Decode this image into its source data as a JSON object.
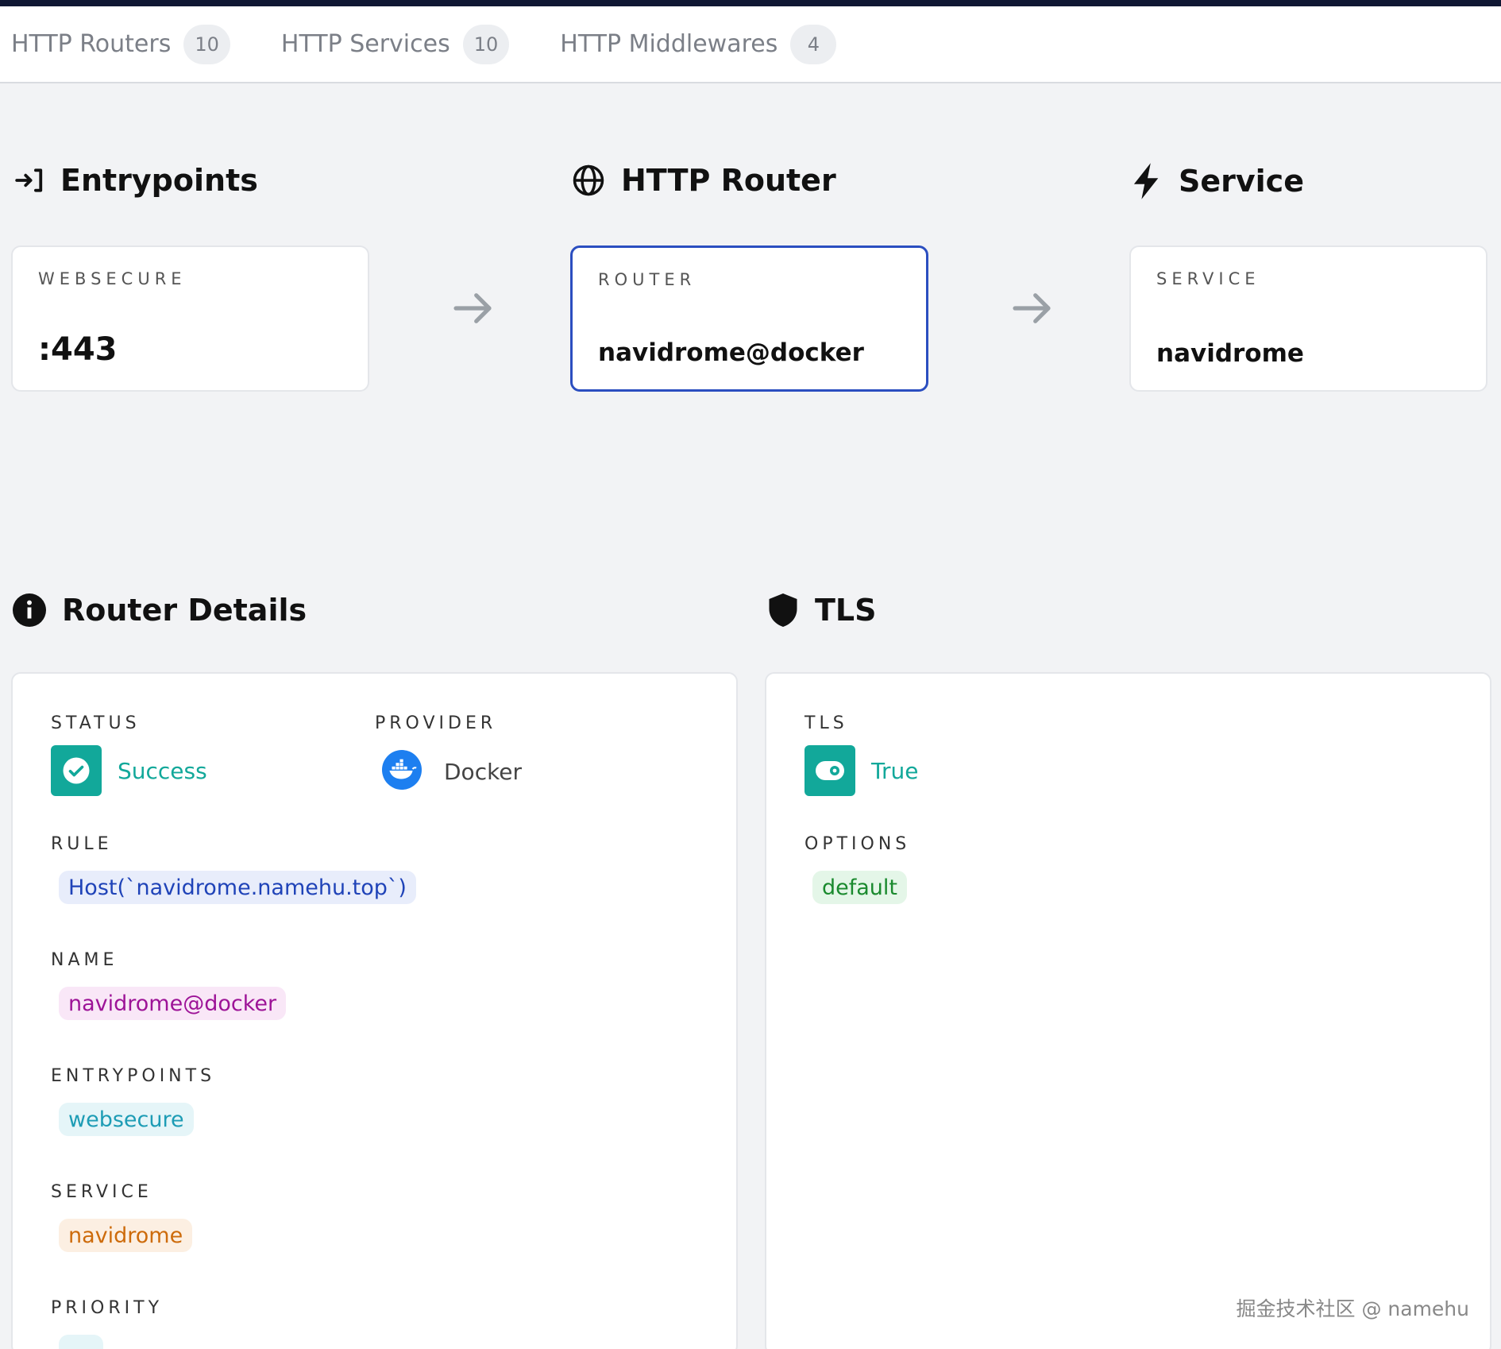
{
  "tabs": [
    {
      "label": "HTTP Routers",
      "count": "10"
    },
    {
      "label": "HTTP Services",
      "count": "10"
    },
    {
      "label": "HTTP Middlewares",
      "count": "4"
    }
  ],
  "flow": {
    "entrypoints": {
      "title": "Entrypoints",
      "caption": "WEBSECURE",
      "value": ":443"
    },
    "router": {
      "title": "HTTP Router",
      "caption": "ROUTER",
      "value": "navidrome@docker"
    },
    "service": {
      "title": "Service",
      "caption": "SERVICE",
      "value": "navidrome"
    }
  },
  "router_details": {
    "title": "Router Details",
    "status": {
      "label": "STATUS",
      "value": "Success"
    },
    "provider": {
      "label": "PROVIDER",
      "value": "Docker"
    },
    "rule": {
      "label": "RULE",
      "value": "Host(`navidrome.namehu.top`)"
    },
    "name": {
      "label": "NAME",
      "value": "navidrome@docker"
    },
    "entrypoints": {
      "label": "ENTRYPOINTS",
      "value": "websecure"
    },
    "service": {
      "label": "SERVICE",
      "value": "navidrome"
    },
    "priority": {
      "label": "PRIORITY"
    }
  },
  "tls": {
    "title": "TLS",
    "tls_field": {
      "label": "TLS",
      "value": "True"
    },
    "options": {
      "label": "OPTIONS",
      "value": "default"
    }
  },
  "watermark": "掘金技术社区 @ namehu",
  "colors": {
    "accent_blue": "#2b4ec0",
    "success_teal": "#12a89a",
    "docker_blue": "#1d7ff0",
    "top_strip": "#101733"
  }
}
